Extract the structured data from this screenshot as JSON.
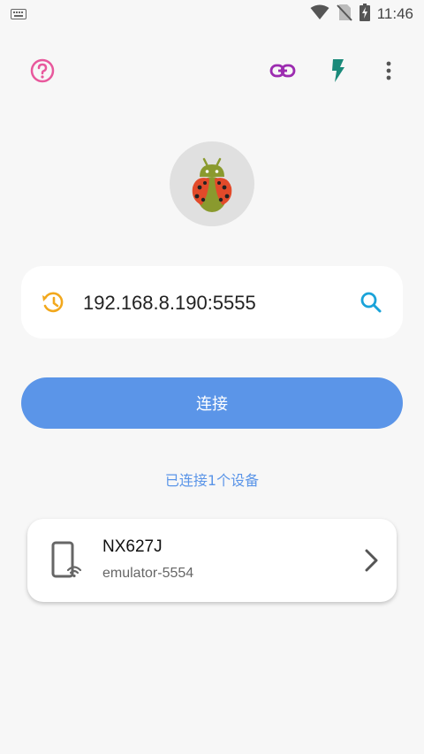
{
  "status_bar": {
    "time": "11:46",
    "icons": [
      "keyboard-icon",
      "wifi-icon",
      "no-signal-icon",
      "battery-charging-icon"
    ]
  },
  "toolbar": {
    "icons": [
      "help-icon",
      "link-icon",
      "flash-icon",
      "more-options-icon"
    ],
    "colors": {
      "help": "#e8589c",
      "link": "#9c2cb0",
      "flash": "#1a8a7a",
      "more": "#555555"
    }
  },
  "logo": {
    "icon": "ladybug-android-logo"
  },
  "address": {
    "value": "192.168.8.190:5555",
    "history_icon": "history-icon",
    "search_icon": "search-icon"
  },
  "connect_button": {
    "label": "连接",
    "color": "#5b95e8"
  },
  "connected_status": {
    "label": "已连接1个设备"
  },
  "devices": [
    {
      "name": "NX627J",
      "serial": "emulator-5554",
      "icon": "wireless-phone-icon"
    }
  ]
}
